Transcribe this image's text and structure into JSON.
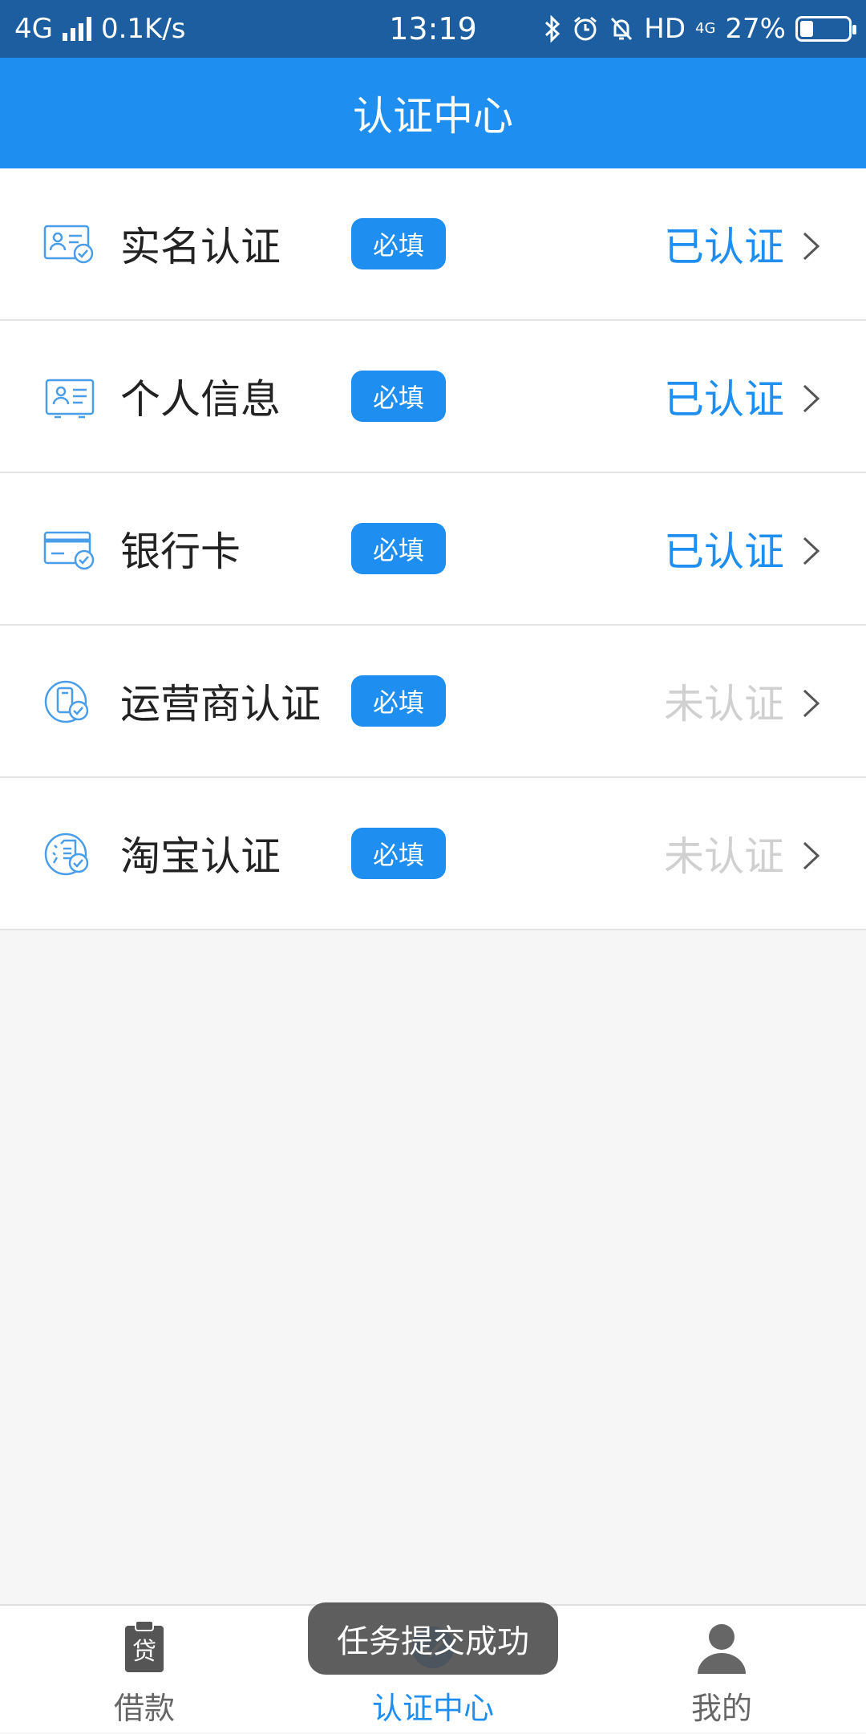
{
  "status_bar": {
    "network": "4G",
    "speed": "0.1K/s",
    "time": "13:19",
    "hd": "HD",
    "net_type": "4G",
    "battery": "27%",
    "battery_level": 0.27
  },
  "header": {
    "title": "认证中心"
  },
  "items": [
    {
      "icon": "id-card-check-icon",
      "title": "实名认证",
      "badge": "必填",
      "status": "已认证",
      "verified": true
    },
    {
      "icon": "profile-card-icon",
      "title": "个人信息",
      "badge": "必填",
      "status": "已认证",
      "verified": true
    },
    {
      "icon": "bank-card-check-icon",
      "title": "银行卡",
      "badge": "必填",
      "status": "已认证",
      "verified": true
    },
    {
      "icon": "phone-check-icon",
      "title": "运营商认证",
      "badge": "必填",
      "status": "未认证",
      "verified": false
    },
    {
      "icon": "taobao-check-icon",
      "title": "淘宝认证",
      "badge": "必填",
      "status": "未认证",
      "verified": false
    }
  ],
  "tabs": [
    {
      "label": "借款",
      "icon": "loan-clipboard-icon",
      "icon_text": "贷",
      "active": false
    },
    {
      "label": "认证中心",
      "icon": "certification-icon",
      "active": true
    },
    {
      "label": "我的",
      "icon": "user-profile-icon",
      "active": false
    }
  ],
  "toast": {
    "text": "任务提交成功"
  },
  "colors": {
    "status_bar": "#1c5e9f",
    "brand": "#1f8ef1",
    "unverified": "#d0d0d0",
    "tab_inactive": "#666666"
  }
}
